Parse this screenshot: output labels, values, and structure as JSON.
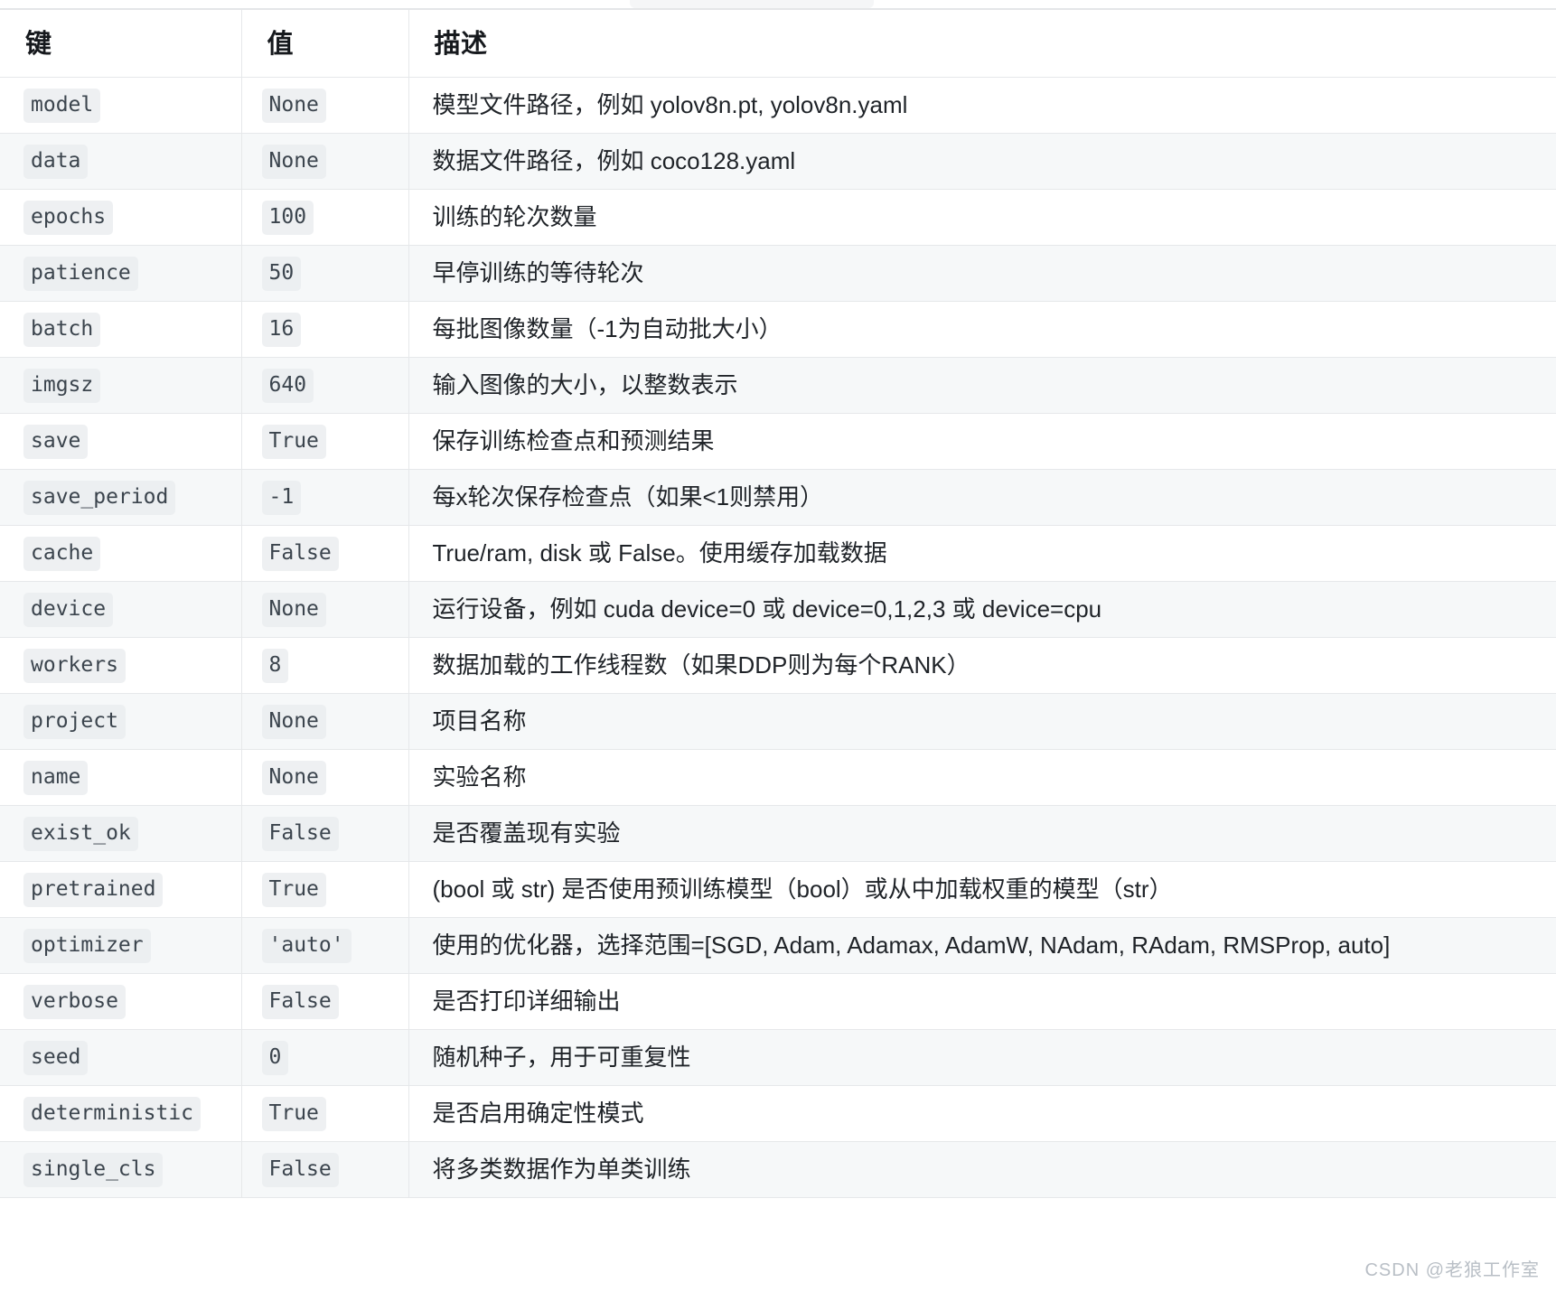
{
  "table": {
    "columns": [
      {
        "key": "key",
        "label": "键"
      },
      {
        "key": "value",
        "label": "值"
      },
      {
        "key": "desc",
        "label": "描述"
      }
    ],
    "rows": [
      {
        "key": "model",
        "value": "None",
        "desc": "模型文件路径，例如 yolov8n.pt, yolov8n.yaml"
      },
      {
        "key": "data",
        "value": "None",
        "desc": "数据文件路径，例如 coco128.yaml"
      },
      {
        "key": "epochs",
        "value": "100",
        "desc": "训练的轮次数量"
      },
      {
        "key": "patience",
        "value": "50",
        "desc": "早停训练的等待轮次"
      },
      {
        "key": "batch",
        "value": "16",
        "desc": "每批图像数量（-1为自动批大小）"
      },
      {
        "key": "imgsz",
        "value": "640",
        "desc": "输入图像的大小，以整数表示"
      },
      {
        "key": "save",
        "value": "True",
        "desc": "保存训练检查点和预测结果"
      },
      {
        "key": "save_period",
        "value": "-1",
        "desc": "每x轮次保存检查点（如果<1则禁用）"
      },
      {
        "key": "cache",
        "value": "False",
        "desc": "True/ram, disk 或 False。使用缓存加载数据"
      },
      {
        "key": "device",
        "value": "None",
        "desc": "运行设备，例如 cuda device=0 或 device=0,1,2,3 或 device=cpu"
      },
      {
        "key": "workers",
        "value": "8",
        "desc": "数据加载的工作线程数（如果DDP则为每个RANK）"
      },
      {
        "key": "project",
        "value": "None",
        "desc": "项目名称"
      },
      {
        "key": "name",
        "value": "None",
        "desc": "实验名称"
      },
      {
        "key": "exist_ok",
        "value": "False",
        "desc": "是否覆盖现有实验"
      },
      {
        "key": "pretrained",
        "value": "True",
        "desc": "(bool 或 str) 是否使用预训练模型（bool）或从中加载权重的模型（str）"
      },
      {
        "key": "optimizer",
        "value": "'auto'",
        "desc": "使用的优化器，选择范围=[SGD, Adam, Adamax, AdamW, NAdam, RAdam, RMSProp, auto]"
      },
      {
        "key": "verbose",
        "value": "False",
        "desc": "是否打印详细输出"
      },
      {
        "key": "seed",
        "value": "0",
        "desc": "随机种子，用于可重复性"
      },
      {
        "key": "deterministic",
        "value": "True",
        "desc": "是否启用确定性模式"
      },
      {
        "key": "single_cls",
        "value": "False",
        "desc": "将多类数据作为单类训练"
      }
    ]
  },
  "watermark": {
    "text": "CSDN @老狼工作室"
  },
  "colors": {
    "border": "#e6e8ea",
    "alt_row": "#f6f8f9",
    "code_bg": "#eef0f2",
    "code_text": "#3b444d",
    "text": "#1f2328",
    "watermark": "#b9bfc6"
  }
}
